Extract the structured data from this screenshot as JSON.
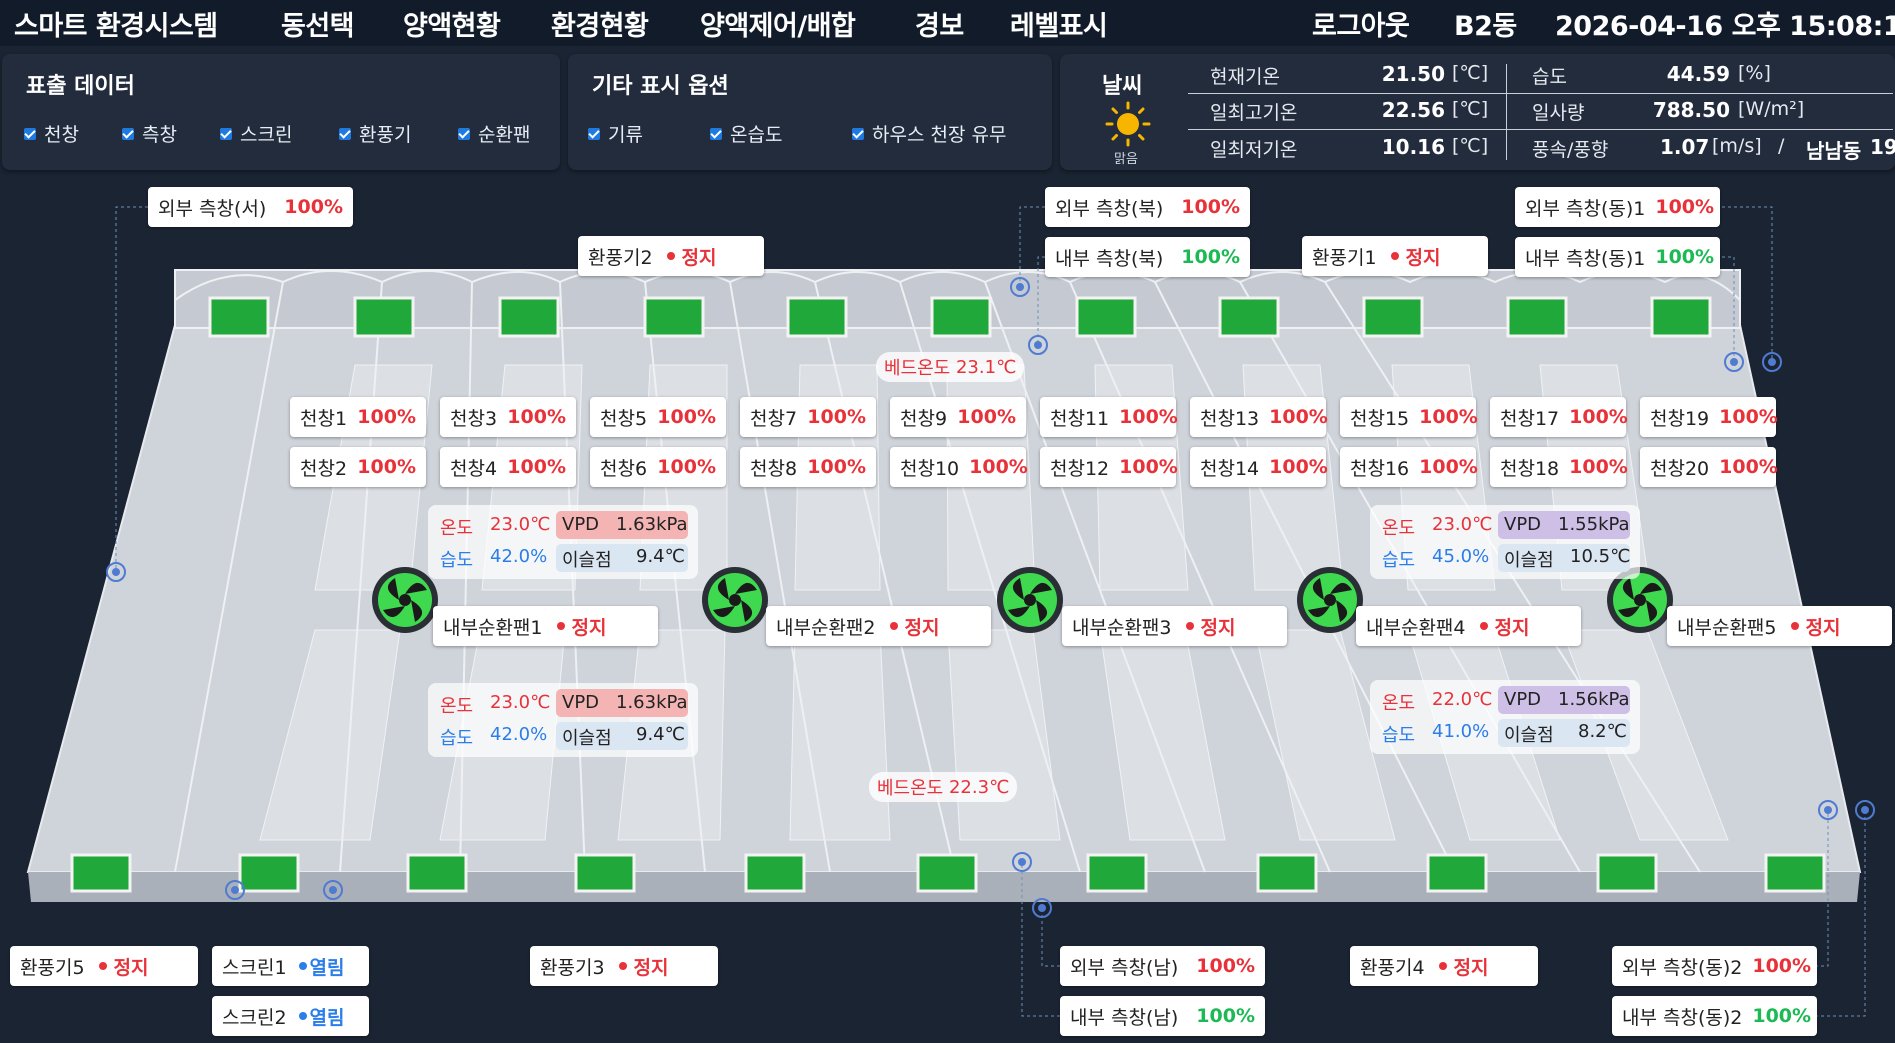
{
  "nav": {
    "title": "스마트 환경시스템",
    "menu": [
      "동선택",
      "양액현황",
      "환경현황",
      "양액제어/배합",
      "경보",
      "레벨표시"
    ],
    "logout": "로그아웃",
    "building": "B2동",
    "datetime": "2026-04-16 오후 15:08:15"
  },
  "display_data": {
    "title": "표출 데이터",
    "options": [
      "천창",
      "측창",
      "스크린",
      "환풍기",
      "순환팬"
    ]
  },
  "other_options": {
    "title": "기타 표시 옵션",
    "options": [
      "기류",
      "온습도",
      "하우스 천장 유무"
    ]
  },
  "weather": {
    "title": "날씨",
    "condition": "맑음",
    "rows": [
      {
        "label": "현재기온",
        "value": "21.50",
        "unit": "[℃]"
      },
      {
        "label": "일최고기온",
        "value": "22.56",
        "unit": "[℃]"
      },
      {
        "label": "일최저기온",
        "value": "10.16",
        "unit": "[℃]"
      }
    ],
    "humidity": {
      "label": "습도",
      "value": "44.59",
      "unit": "[%]"
    },
    "solar": {
      "label": "일사량",
      "value": "788.50",
      "unit": "[W/m²]"
    },
    "wind": {
      "label": "풍속/풍향",
      "speed": "1.07",
      "speed_unit": "[m/s]",
      "sep": "/",
      "direction": "남남동",
      "deg": "19",
      "deg_unit": "[°]"
    }
  },
  "side_windows": [
    {
      "label": "외부 측창(서)",
      "value": "100%"
    },
    {
      "label": "외부 측창(북)",
      "value": "100%"
    },
    {
      "label": "내부 측창(북)",
      "value": "100%"
    },
    {
      "label": "외부 측창(동)1",
      "value": "100%"
    },
    {
      "label": "내부 측창(동)1",
      "value": "100%"
    },
    {
      "label": "외부 측창(남)",
      "value": "100%"
    },
    {
      "label": "내부 측창(남)",
      "value": "100%"
    },
    {
      "label": "외부 측창(동)2",
      "value": "100%"
    },
    {
      "label": "내부 측창(동)2",
      "value": "100%"
    }
  ],
  "ventilators": [
    {
      "label": "환풍기2",
      "status": "정지"
    },
    {
      "label": "환풍기1",
      "status": "정지"
    },
    {
      "label": "환풍기5",
      "status": "정지"
    },
    {
      "label": "환풍기3",
      "status": "정지"
    },
    {
      "label": "환풍기4",
      "status": "정지"
    }
  ],
  "screens": [
    {
      "label": "스크린1",
      "status": "열림"
    },
    {
      "label": "스크린2",
      "status": "열림"
    }
  ],
  "roof_windows": [
    {
      "label": "천창1",
      "value": "100%"
    },
    {
      "label": "천창2",
      "value": "100%"
    },
    {
      "label": "천창3",
      "value": "100%"
    },
    {
      "label": "천창4",
      "value": "100%"
    },
    {
      "label": "천창5",
      "value": "100%"
    },
    {
      "label": "천창6",
      "value": "100%"
    },
    {
      "label": "천창7",
      "value": "100%"
    },
    {
      "label": "천창8",
      "value": "100%"
    },
    {
      "label": "천창9",
      "value": "100%"
    },
    {
      "label": "천창10",
      "value": "100%"
    },
    {
      "label": "천창11",
      "value": "100%"
    },
    {
      "label": "천창12",
      "value": "100%"
    },
    {
      "label": "천창13",
      "value": "100%"
    },
    {
      "label": "천창14",
      "value": "100%"
    },
    {
      "label": "천창15",
      "value": "100%"
    },
    {
      "label": "천창16",
      "value": "100%"
    },
    {
      "label": "천창17",
      "value": "100%"
    },
    {
      "label": "천창18",
      "value": "100%"
    },
    {
      "label": "천창19",
      "value": "100%"
    },
    {
      "label": "천창20",
      "value": "100%"
    }
  ],
  "bed_temps": [
    {
      "label": "베드온도",
      "value": "23.1℃"
    },
    {
      "label": "베드온도",
      "value": "22.3℃"
    }
  ],
  "circ_fans": [
    {
      "label": "내부순환팬1",
      "status": "정지"
    },
    {
      "label": "내부순환팬2",
      "status": "정지"
    },
    {
      "label": "내부순환팬3",
      "status": "정지"
    },
    {
      "label": "내부순환팬4",
      "status": "정지"
    },
    {
      "label": "내부순환팬5",
      "status": "정지"
    }
  ],
  "env_sensors": [
    {
      "temp_label": "온도",
      "temp": "23.0℃",
      "hum_label": "습도",
      "hum": "42.0%",
      "vpd_label": "VPD",
      "vpd": "1.63kPa",
      "dew_label": "이슬점",
      "dew": "9.4℃"
    },
    {
      "temp_label": "온도",
      "temp": "23.0℃",
      "hum_label": "습도",
      "hum": "45.0%",
      "vpd_label": "VPD",
      "vpd": "1.55kPa",
      "dew_label": "이슬점",
      "dew": "10.5℃"
    },
    {
      "temp_label": "온도",
      "temp": "23.0℃",
      "hum_label": "습도",
      "hum": "42.0%",
      "vpd_label": "VPD",
      "vpd": "1.63kPa",
      "dew_label": "이슬점",
      "dew": "9.4℃"
    },
    {
      "temp_label": "온도",
      "temp": "22.0℃",
      "hum_label": "습도",
      "hum": "41.0%",
      "vpd_label": "VPD",
      "vpd": "1.56kPa",
      "dew_label": "이슬점",
      "dew": "8.2℃"
    }
  ],
  "colors": {
    "background": "#1b2433",
    "panel": "#222c3d",
    "stop": "#e8323a",
    "open": "#2b7de9",
    "ok_green": "#1db954",
    "vpd_red": "#f4b4b4",
    "vpd_purple": "#cdbfe6"
  }
}
